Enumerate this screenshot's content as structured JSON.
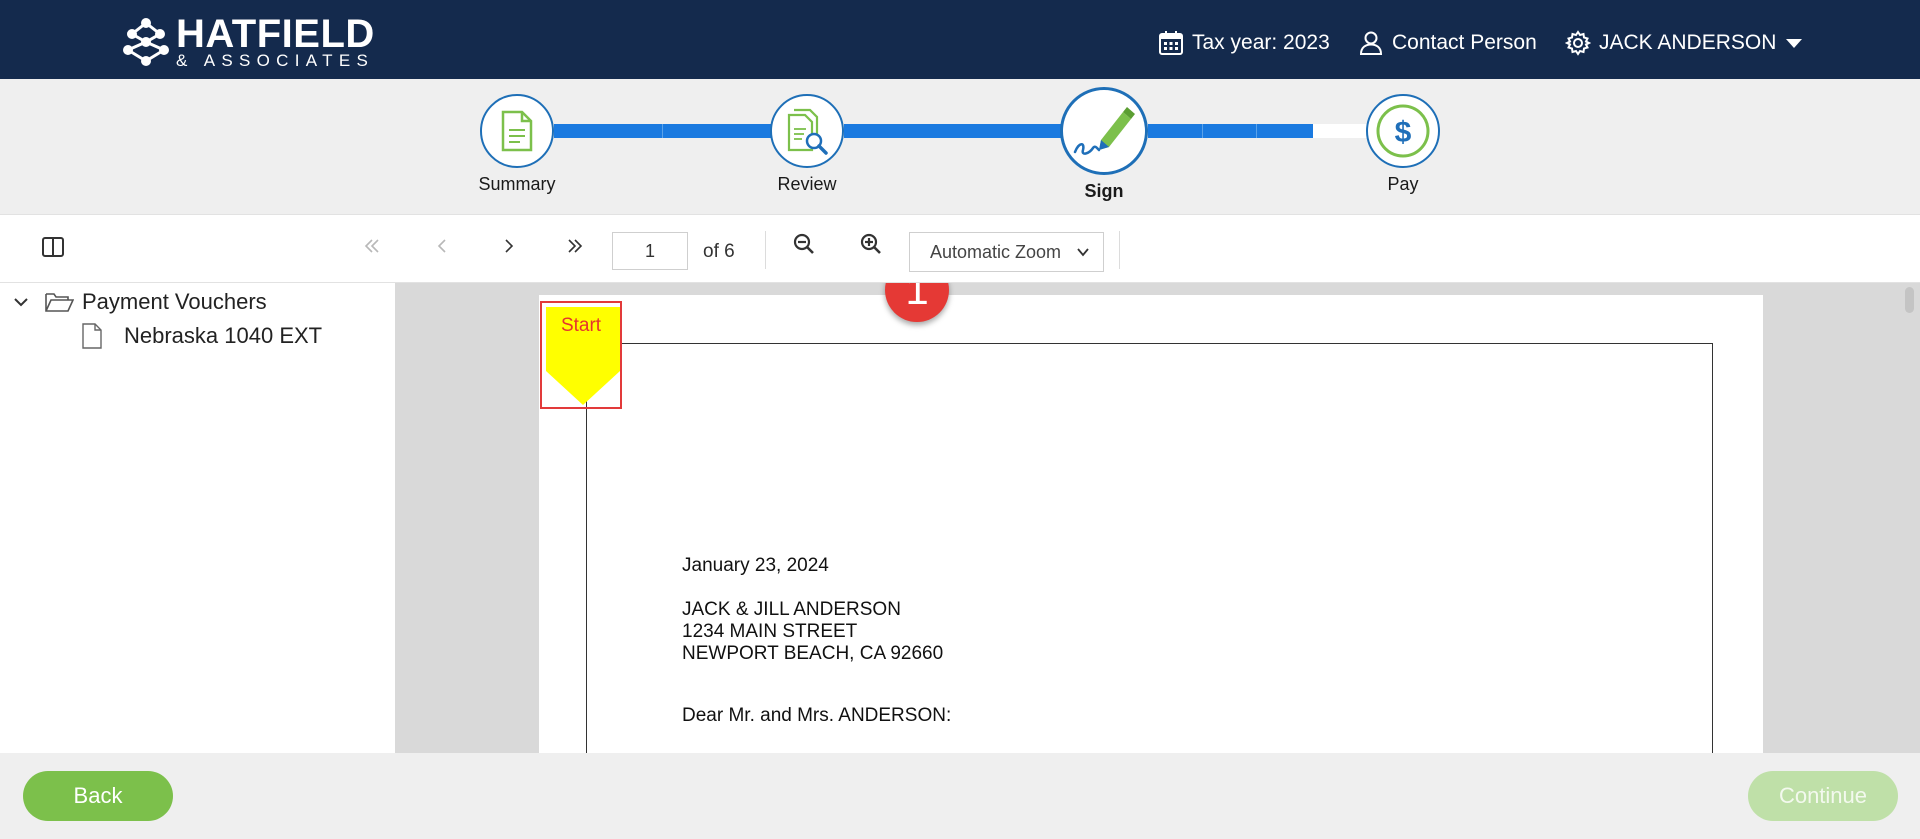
{
  "header": {
    "logo_main": "HATFIELD",
    "logo_sub": "& ASSOCIATES",
    "tax_year": "Tax year: 2023",
    "contact": "Contact Person",
    "user": "JACK ANDERSON"
  },
  "stepper": {
    "steps": [
      {
        "label": "Summary",
        "icon": "document-icon"
      },
      {
        "label": "Review",
        "icon": "review-search-icon"
      },
      {
        "label": "Sign",
        "icon": "pen-signature-icon",
        "active": true
      },
      {
        "label": "Pay",
        "icon": "dollar-icon"
      }
    ],
    "colors": {
      "progress": "#1a7ae0",
      "circle_border": "#1e6fb7",
      "icon_green": "#7cc04b",
      "icon_blue": "#1f6fb9"
    }
  },
  "toolbar": {
    "page_value": "1",
    "page_count": "of 6",
    "zoom": "Automatic Zoom"
  },
  "sidebar": {
    "folder": "Payment Vouchers",
    "file": "Nebraska 1040 EXT"
  },
  "document": {
    "start_label": "Start",
    "badge": "1",
    "date": "January 23, 2024",
    "name": "JACK & JILL ANDERSON",
    "street": "1234 MAIN STREET",
    "city": "NEWPORT BEACH, CA  92660",
    "salutation": "Dear Mr. and Mrs. ANDERSON:"
  },
  "footer": {
    "back": "Back",
    "continue": "Continue"
  }
}
